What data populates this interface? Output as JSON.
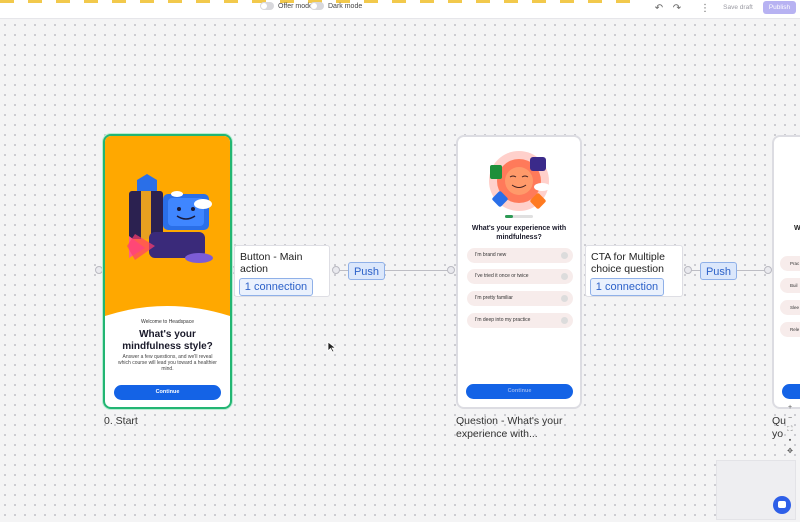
{
  "topbar": {
    "offer_mode": "Offer mode",
    "dark_mode": "Dark mode",
    "save_draft": "Save draft",
    "publish": "Publish"
  },
  "start_screen": {
    "welcome": "Welcome to Headspace",
    "title": "What's your mindfulness style?",
    "body": "Answer a few questions, and we'll reveal which course will lead you toward a healthier mind.",
    "cta": "Continue",
    "label": "0. Start"
  },
  "connector1": {
    "title": "Button - Main action",
    "badge": "1 connection",
    "push": "Push"
  },
  "question_screen": {
    "title": "What's your experience with mindfulness?",
    "options": [
      "I'm brand new",
      "I've tried it once or twice",
      "I'm pretty familiar",
      "I'm deep into my practice"
    ],
    "cta": "Continue",
    "label": "Question - What's your experience with..."
  },
  "connector2": {
    "title": "CTA for Multiple choice question",
    "badge": "1 connection",
    "push": "Push"
  },
  "partial_screen": {
    "title_fragment": "W",
    "options": [
      "Prac",
      "Buil",
      "Slee",
      "Rele"
    ],
    "label_line1": "Qu",
    "label_line2": "yo"
  },
  "colors": {
    "accent": "#2d62c9",
    "selected_border": "#22b573",
    "cta_blue": "#1463e6",
    "orange": "#ffa800"
  }
}
